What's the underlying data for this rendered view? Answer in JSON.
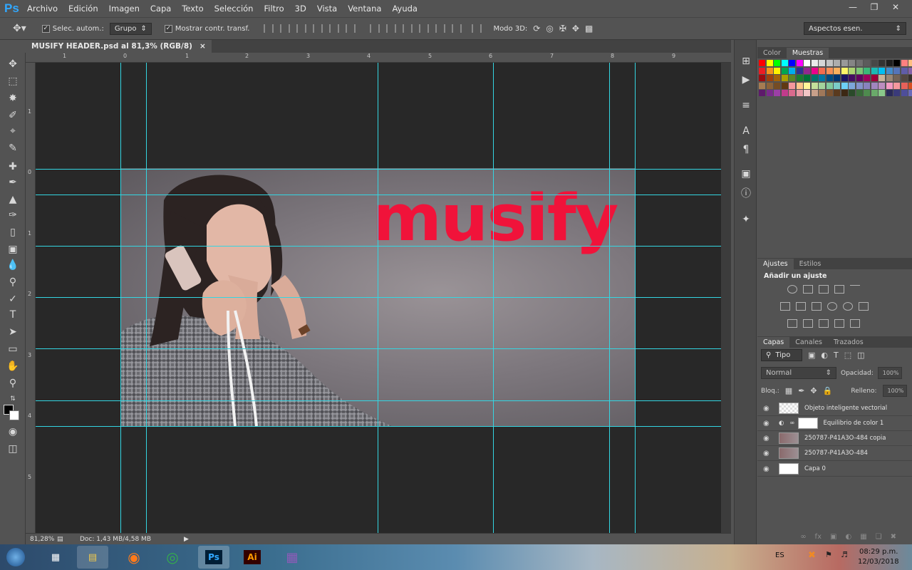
{
  "app": {
    "logo": "Ps"
  },
  "menu": [
    "Archivo",
    "Edición",
    "Imagen",
    "Capa",
    "Texto",
    "Selección",
    "Filtro",
    "3D",
    "Vista",
    "Ventana",
    "Ayuda"
  ],
  "options": {
    "auto_select_label": "Selec. autom.:",
    "auto_select_value": "Grupo",
    "transform_label": "Mostrar contr. transf.",
    "mode3d_label": "Modo 3D:",
    "workspace": "Aspectos esen."
  },
  "document": {
    "tab_title": "MUSIFY HEADER.psd al 81,3% (RGB/8)",
    "logo_text": "musify"
  },
  "status": {
    "zoom": "81,28%",
    "doc_size": "Doc: 1,43 MB/4,58 MB"
  },
  "ruler_top": [
    "1",
    "0",
    "1",
    "2",
    "3",
    "4",
    "5",
    "6",
    "7",
    "8",
    "9"
  ],
  "ruler_left": [
    "1",
    "0",
    "1",
    "2",
    "3",
    "4",
    "5"
  ],
  "color_panel": {
    "tabs": [
      "Color",
      "Muestras"
    ],
    "active": "Muestras"
  },
  "adjust_panel": {
    "tabs": [
      "Ajustes",
      "Estilos"
    ],
    "heading": "Añadir un ajuste"
  },
  "layers_panel": {
    "tabs": [
      "Capas",
      "Canales",
      "Trazados"
    ],
    "filter_label": "Tipo",
    "blend_mode": "Normal",
    "opacity_label": "Opacidad:",
    "opacity_value": "100%",
    "lock_label": "Bloq.:",
    "fill_label": "Relleno:",
    "fill_value": "100%",
    "layers": [
      {
        "name": "Objeto inteligente vectorial",
        "thumb": "checker"
      },
      {
        "name": "Equilibrio de color 1",
        "thumb": "adjust"
      },
      {
        "name": "250787-P41A3O-484 copia",
        "thumb": "photo"
      },
      {
        "name": "250787-P41A3O-484",
        "thumb": "photo"
      },
      {
        "name": "Capa 0",
        "thumb": "white"
      }
    ]
  },
  "taskbar": {
    "lang": "ES",
    "time": "08:29 p.m.",
    "date": "12/03/2018",
    "apps": [
      "start",
      "calculator",
      "explorer",
      "firefox",
      "chrome",
      "Ps",
      "Ai",
      "winrar"
    ]
  },
  "colors": {
    "guide": "#34d6e2",
    "logo": "#f0133a",
    "accent_ps": "#31a8ff"
  }
}
